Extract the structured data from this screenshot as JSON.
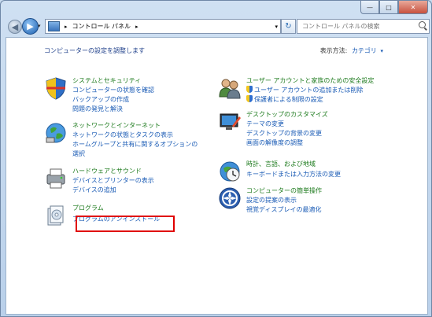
{
  "window": {
    "minimize_label": "—",
    "maximize_label": "□",
    "close_label": "✕"
  },
  "nav": {
    "back_glyph": "◀",
    "forward_glyph": "▶",
    "dropdown_glyph": "▾",
    "refresh_glyph": "↻"
  },
  "address": {
    "segments": [
      "コントロール パネル"
    ],
    "separator": "▸"
  },
  "search": {
    "placeholder": "コントロール パネルの検索"
  },
  "main": {
    "heading": "コンピューターの設定を調整します",
    "view_by_label": "表示方法:",
    "view_by_value": "カテゴリ"
  },
  "categories": {
    "system": {
      "title": "システムとセキュリティ",
      "links": [
        "コンピューターの状態を確認",
        "バックアップの作成",
        "問題の発見と解決"
      ]
    },
    "network": {
      "title": "ネットワークとインターネット",
      "links": [
        "ネットワークの状態とタスクの表示",
        "ホームグループと共有に関するオプションの",
        "選択"
      ]
    },
    "hardware": {
      "title": "ハードウェアとサウンド",
      "links": [
        "デバイスとプリンターの表示",
        "デバイスの追加"
      ]
    },
    "programs": {
      "title": "プログラム",
      "links": [
        "プログラムのアンインストール"
      ]
    },
    "users": {
      "title": "ユーザー アカウントと家族のための安全設定",
      "links": [
        "ユーザー アカウントの追加または削除",
        "保護者による制限の設定"
      ]
    },
    "appearance": {
      "title": "デスクトップのカスタマイズ",
      "links": [
        "テーマの変更",
        "デスクトップの背景の変更",
        "画面の解像度の調整"
      ]
    },
    "clock": {
      "title": "時計、言語、および地域",
      "links": [
        "キーボードまたは入力方法の変更"
      ]
    },
    "ease": {
      "title": "コンピューターの簡単操作",
      "links": [
        "設定の提案の表示",
        "視覚ディスプレイの最適化"
      ]
    }
  },
  "colors": {
    "category_title": "#1c7a1c",
    "link": "#1a5bb5",
    "highlight": "#e00000"
  }
}
